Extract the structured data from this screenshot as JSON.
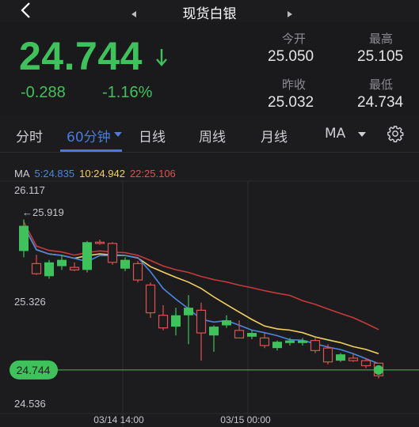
{
  "header": {
    "title": "现货白银"
  },
  "quote": {
    "price": "24.744",
    "change": "-0.288",
    "change_pct": "-1.16%",
    "open_label": "今开",
    "open": "25.050",
    "high_label": "最高",
    "high": "25.105",
    "prev_close_label": "昨收",
    "prev_close": "25.032",
    "low_label": "最低",
    "low": "24.734"
  },
  "tabs": [
    {
      "label": "分时"
    },
    {
      "label": "60分钟"
    },
    {
      "label": "日线"
    },
    {
      "label": "周线"
    },
    {
      "label": "月线"
    },
    {
      "label": "MA"
    }
  ],
  "ma": {
    "label": "MA",
    "ma5": "5:24.835",
    "ma10": "10:24.942",
    "ma22": "22:25.106"
  },
  "colors": {
    "up": "#3fc25b",
    "down": "#e05050",
    "accent": "#4a7bdc",
    "ma5": "#4a87e0",
    "ma10": "#f3d060",
    "ma22": "#c83a3a"
  },
  "chart_data": {
    "type": "candlestick",
    "y_ticks": [
      "26.117",
      "25.326",
      "24.536"
    ],
    "y_ticks_values": [
      26.117,
      25.326,
      24.536
    ],
    "x_ticks": [
      "03/14 14:00",
      "03/15 00:00"
    ],
    "max_marker": "25.919",
    "current_price_tag": "24.744",
    "ylim": [
      24.536,
      26.117
    ],
    "candles": [
      {
        "o": 25.65,
        "h": 25.9,
        "l": 25.6,
        "c": 25.85
      },
      {
        "o": 25.55,
        "h": 25.62,
        "l": 25.46,
        "c": 25.47
      },
      {
        "o": 25.45,
        "h": 25.58,
        "l": 25.43,
        "c": 25.56
      },
      {
        "o": 25.53,
        "h": 25.62,
        "l": 25.5,
        "c": 25.58
      },
      {
        "o": 25.52,
        "h": 25.56,
        "l": 25.49,
        "c": 25.5
      },
      {
        "o": 25.5,
        "h": 25.73,
        "l": 25.48,
        "c": 25.72
      },
      {
        "o": 25.72,
        "h": 25.74,
        "l": 25.7,
        "c": 25.71
      },
      {
        "o": 25.71,
        "h": 25.72,
        "l": 25.54,
        "c": 25.56
      },
      {
        "o": 25.51,
        "h": 25.6,
        "l": 25.49,
        "c": 25.58
      },
      {
        "o": 25.55,
        "h": 25.57,
        "l": 25.4,
        "c": 25.42
      },
      {
        "o": 25.38,
        "h": 25.4,
        "l": 25.12,
        "c": 25.16
      },
      {
        "o": 25.14,
        "h": 25.22,
        "l": 25.02,
        "c": 25.04
      },
      {
        "o": 25.05,
        "h": 25.2,
        "l": 24.98,
        "c": 25.14
      },
      {
        "o": 25.14,
        "h": 25.3,
        "l": 24.91,
        "c": 25.2
      },
      {
        "o": 25.18,
        "h": 25.24,
        "l": 24.78,
        "c": 25.0
      },
      {
        "o": 24.98,
        "h": 25.06,
        "l": 24.85,
        "c": 25.05
      },
      {
        "o": 25.06,
        "h": 25.14,
        "l": 25.04,
        "c": 25.1
      },
      {
        "o": 25.02,
        "h": 25.1,
        "l": 24.96,
        "c": 24.96
      },
      {
        "o": 24.97,
        "h": 25.02,
        "l": 24.95,
        "c": 25.0
      },
      {
        "o": 24.96,
        "h": 25.0,
        "l": 24.88,
        "c": 24.9
      },
      {
        "o": 24.88,
        "h": 24.94,
        "l": 24.86,
        "c": 24.93
      },
      {
        "o": 24.92,
        "h": 24.96,
        "l": 24.9,
        "c": 24.94
      },
      {
        "o": 24.92,
        "h": 24.96,
        "l": 24.9,
        "c": 24.94
      },
      {
        "o": 24.94,
        "h": 24.96,
        "l": 24.84,
        "c": 24.86
      },
      {
        "o": 24.88,
        "h": 24.91,
        "l": 24.75,
        "c": 24.77
      },
      {
        "o": 24.78,
        "h": 24.84,
        "l": 24.77,
        "c": 24.83
      },
      {
        "o": 24.8,
        "h": 24.84,
        "l": 24.77,
        "c": 24.78
      },
      {
        "o": 24.78,
        "h": 24.8,
        "l": 24.72,
        "c": 24.74
      },
      {
        "o": 24.76,
        "h": 24.76,
        "l": 24.64,
        "c": 24.66
      }
    ]
  }
}
